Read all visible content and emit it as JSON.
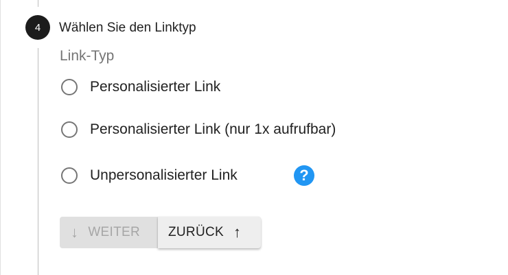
{
  "step": {
    "number": "4",
    "title": "Wählen Sie den Linktyp"
  },
  "field": {
    "label": "Link-Typ",
    "options": [
      {
        "label": "Personalisierter Link",
        "selected": false
      },
      {
        "label": "Personalisierter Link (nur 1x aufrufbar)",
        "selected": false
      },
      {
        "label": "Unpersonalisierter Link",
        "selected": false
      }
    ],
    "help_icon": "?"
  },
  "buttons": {
    "next_label": "WEITER",
    "next_icon": "↓",
    "next_enabled": false,
    "back_label": "ZURÜCK",
    "back_icon": "↑"
  },
  "colors": {
    "step_circle": "#1c1c1c",
    "help_icon": "#2196f3",
    "disabled_text": "#a6a6a6"
  }
}
